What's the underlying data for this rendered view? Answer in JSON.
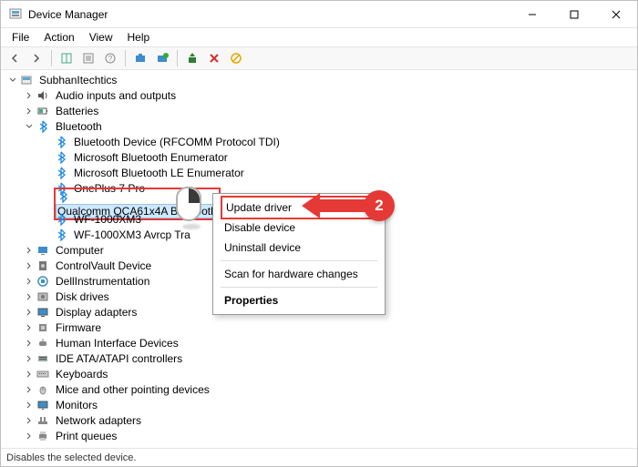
{
  "window": {
    "title": "Device Manager"
  },
  "menu": {
    "file": "File",
    "action": "Action",
    "view": "View",
    "help": "Help"
  },
  "tree": {
    "root": "SubhanItechtics",
    "nodes": [
      {
        "label": "Audio inputs and outputs",
        "icon": "audio"
      },
      {
        "label": "Batteries",
        "icon": "battery"
      },
      {
        "label": "Bluetooth",
        "icon": "bluetooth",
        "expanded": true,
        "children": [
          {
            "label": "Bluetooth Device (RFCOMM Protocol TDI)",
            "icon": "bluetooth"
          },
          {
            "label": "Microsoft Bluetooth Enumerator",
            "icon": "bluetooth"
          },
          {
            "label": "Microsoft Bluetooth LE Enumerator",
            "icon": "bluetooth"
          },
          {
            "label": "OnePlus 7 Pro",
            "icon": "bluetooth"
          },
          {
            "label": "Qualcomm QCA61x4A Bluetooth",
            "icon": "bluetooth",
            "selected": true
          },
          {
            "label": "WF-1000XM3",
            "icon": "bluetooth"
          },
          {
            "label": "WF-1000XM3 Avrcp Tra",
            "icon": "bluetooth",
            "truncated": true
          }
        ]
      },
      {
        "label": "Computer",
        "icon": "computer"
      },
      {
        "label": "ControlVault Device",
        "icon": "vault"
      },
      {
        "label": "DellInstrumentation",
        "icon": "dell"
      },
      {
        "label": "Disk drives",
        "icon": "disk"
      },
      {
        "label": "Display adapters",
        "icon": "display"
      },
      {
        "label": "Firmware",
        "icon": "firmware"
      },
      {
        "label": "Human Interface Devices",
        "icon": "hid"
      },
      {
        "label": "IDE ATA/ATAPI controllers",
        "icon": "ide"
      },
      {
        "label": "Keyboards",
        "icon": "keyboard"
      },
      {
        "label": "Mice and other pointing devices",
        "icon": "mouse"
      },
      {
        "label": "Monitors",
        "icon": "monitor"
      },
      {
        "label": "Network adapters",
        "icon": "network"
      },
      {
        "label": "Print queues",
        "icon": "print",
        "truncated": true
      }
    ]
  },
  "context_menu": {
    "update": "Update driver",
    "disable": "Disable device",
    "uninstall": "Uninstall device",
    "scan": "Scan for hardware changes",
    "properties": "Properties"
  },
  "annotation": {
    "step_number": "2"
  },
  "status": "Disables the selected device."
}
